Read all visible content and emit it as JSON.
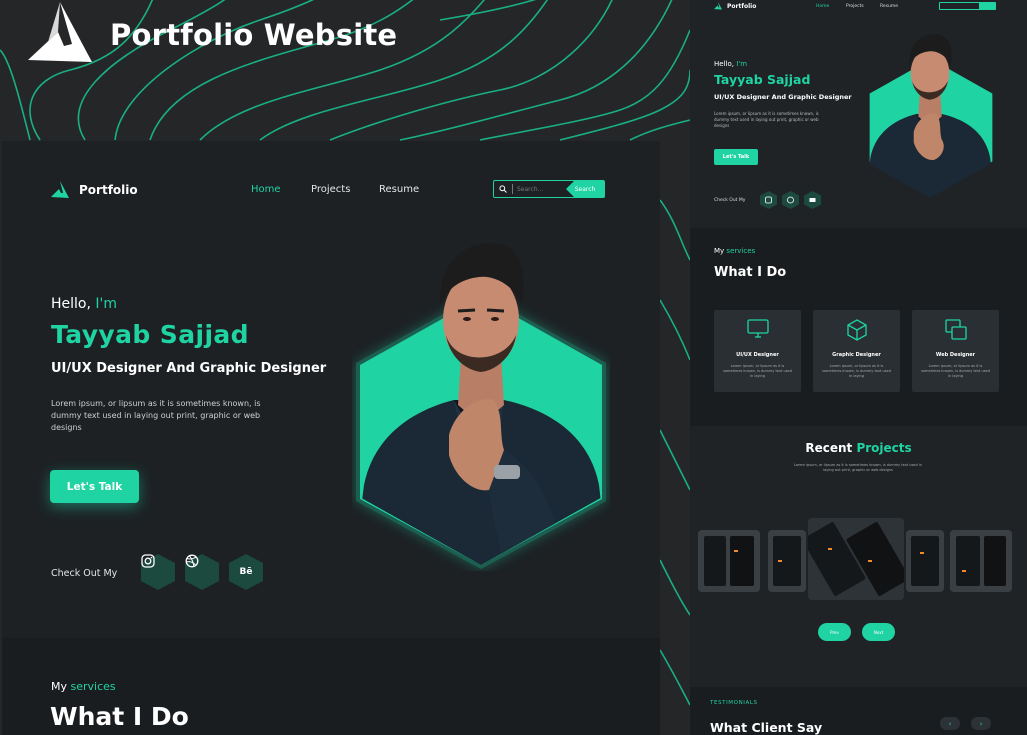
{
  "brand": {
    "title": "Portfolio Website"
  },
  "colors": {
    "accent": "#1fd3a3",
    "background": "#242628",
    "panel": "#1d2124",
    "card": "#2a2f33"
  },
  "main": {
    "nav": {
      "logo_text": "Portfolio",
      "links": [
        "Home",
        "Projects",
        "Resume"
      ],
      "active": "Home",
      "search_placeholder": "Search...",
      "search_button": "Search"
    },
    "hero": {
      "greeting": "Hello,",
      "greeting_accent": "I'm",
      "name": "Tayyab Sajjad",
      "role": "UI/UX Designer And Graphic Designer",
      "description": "Lorem ipsum, or lipsum as it is sometimes known, is dummy text used in laying out print, graphic or web designs",
      "cta": "Let's Talk",
      "check_out": "Check Out My",
      "social_icons": [
        "instagram-icon",
        "dribbble-icon",
        "behance-icon"
      ],
      "behance_label": "Bē"
    },
    "services": {
      "sub": "My",
      "sub_accent": "services",
      "title": "What I Do"
    }
  },
  "side": {
    "nav": {
      "logo_text": "Portfolio",
      "links": [
        "Home",
        "Projects",
        "Resume"
      ]
    },
    "hero": {
      "greeting": "Hello,",
      "greeting_accent": "I'm",
      "name": "Tayyab Sajjad",
      "role": "UI/UX Designer And Graphic Designer",
      "description": "Lorem ipsum, or lipsum as it is sometimes known, is dummy text used in laying out print, graphic or web designs",
      "cta": "Let's Talk",
      "check_out": "Check Out My"
    },
    "services": {
      "sub": "My",
      "sub_accent": "services",
      "title": "What I Do",
      "cards": [
        {
          "title": "UI/UX Designer",
          "desc": "Lorem ipsum, or lipsum as it is sometimes known, is dummy text used in laying"
        },
        {
          "title": "Graphic Designer",
          "desc": "Lorem ipsum, or lipsum as it is sometimes known, is dummy text used in laying"
        },
        {
          "title": "Web Designer",
          "desc": "Lorem ipsum, or lipsum as it is sometimes known, is dummy text used in laying"
        }
      ]
    },
    "projects": {
      "title": "Recent",
      "title_accent": "Projects",
      "desc": "Lorem ipsum, or lipsum as it is sometimes known, is dummy text used in laying out print, graphic or web designs",
      "prev": "Prev",
      "next": "Next"
    },
    "testimonials": {
      "sub": "TESTIMONIALS",
      "title": "What Client Say"
    }
  }
}
